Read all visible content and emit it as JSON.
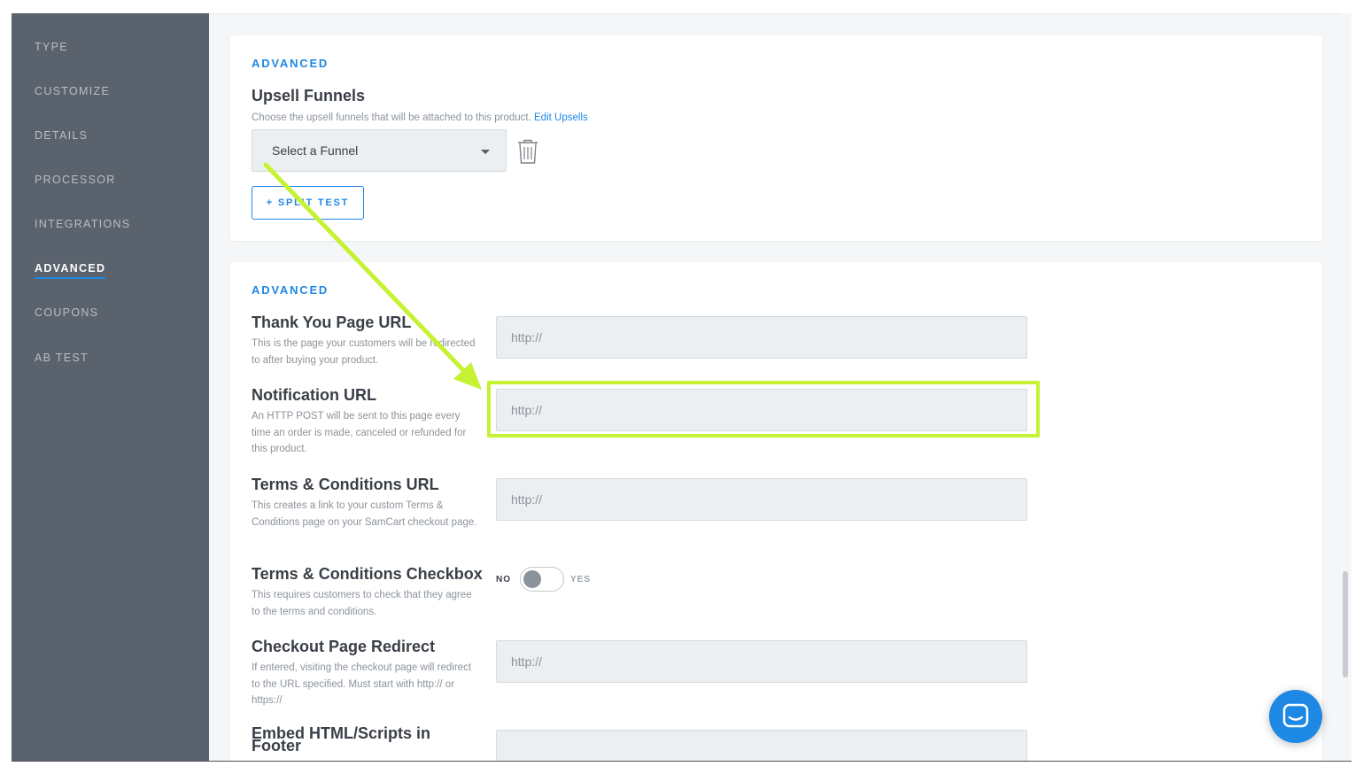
{
  "sidebar": {
    "items": [
      {
        "label": "TYPE"
      },
      {
        "label": "CUSTOMIZE"
      },
      {
        "label": "DETAILS"
      },
      {
        "label": "PROCESSOR"
      },
      {
        "label": "INTEGRATIONS"
      },
      {
        "label": "ADVANCED",
        "active": true
      },
      {
        "label": "COUPONS"
      },
      {
        "label": "AB TEST"
      }
    ]
  },
  "upsell_card": {
    "section_label": "ADVANCED",
    "title": "Upsell Funnels",
    "description": "Choose the upsell funnels that will be attached to this product.",
    "edit_link": "Edit Upsells",
    "select_value": "Select a Funnel",
    "split_test_label": "+ SPLIT TEST"
  },
  "advanced_card": {
    "section_label": "ADVANCED",
    "fields": {
      "thank_you": {
        "title": "Thank You Page URL",
        "description": "This is the page your customers will be redirected to after buying your product.",
        "placeholder": "http://"
      },
      "notification": {
        "title": "Notification URL",
        "description": "An HTTP POST will be sent to this page every time an order is made, canceled or refunded for this product.",
        "placeholder": "http://"
      },
      "terms_url": {
        "title": "Terms & Conditions URL",
        "description": "This creates a link to your custom Terms & Conditions page on your SamCart checkout page.",
        "placeholder": "http://"
      },
      "terms_checkbox": {
        "title": "Terms & Conditions Checkbox",
        "description": "This requires customers to check that they agree to the terms and conditions.",
        "no_label": "NO",
        "yes_label": "YES",
        "enabled": false
      },
      "checkout_redirect": {
        "title": "Checkout Page Redirect",
        "description": "If entered, visiting the checkout page will redirect to the URL specified. Must start with http:// or https://",
        "placeholder": "http://"
      },
      "embed_footer": {
        "title": "Embed HTML/Scripts in Footer"
      }
    }
  },
  "colors": {
    "accent": "#1e88e5",
    "sidebar": "#5a626d",
    "highlight": "#c5f233"
  },
  "icons": {
    "trash": "trash-icon",
    "chat": "chat-icon",
    "caret": "chevron-down-icon"
  }
}
